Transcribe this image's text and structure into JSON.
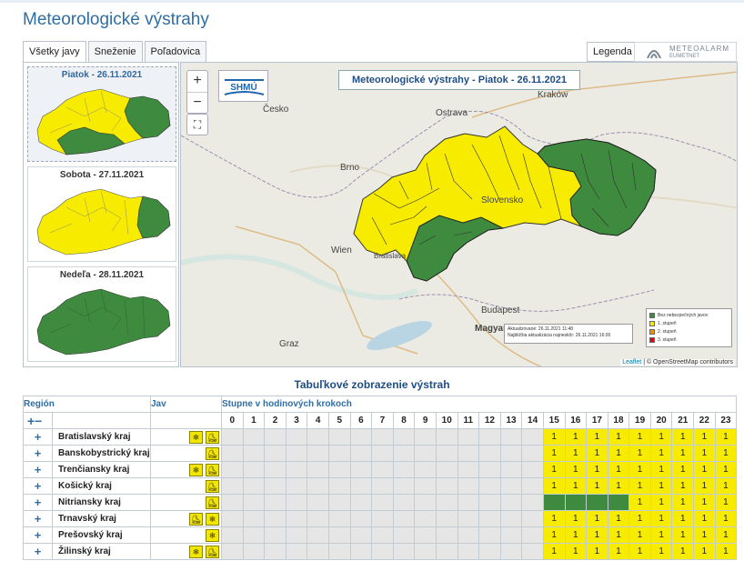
{
  "page": {
    "title": "Meteorologické výstrahy"
  },
  "tabs": [
    {
      "label": "Všetky javy",
      "active": true
    },
    {
      "label": "Sneženie",
      "active": false
    },
    {
      "label": "Poľadovica",
      "active": false
    }
  ],
  "legend_tab": {
    "label": "Legenda"
  },
  "meteoalarm": {
    "line1": "METEOALARM",
    "line2": "EUMETNET"
  },
  "days": [
    {
      "label": "Piatok - 26.11.2021",
      "selected": true
    },
    {
      "label": "Sobota - 27.11.2021",
      "selected": false
    },
    {
      "label": "Nedeľa - 28.11.2021",
      "selected": false
    }
  ],
  "map": {
    "title": "Meteorologické výstrahy - Piatok - 26.11.2021",
    "logo_text": "SHMÚ",
    "zoom_in": "+",
    "zoom_out": "−",
    "fullscreen": "⛶",
    "cities": [
      "Česko",
      "Ostrava",
      "Kraków",
      "Brno",
      "Slovensko",
      "Wien",
      "Bratislava",
      "Budapest",
      "Magyar",
      "Graz"
    ],
    "legend": [
      {
        "label": "Bez nebezpečných javov",
        "color": "#3e8a3f"
      },
      {
        "label": "1. stupeň",
        "color": "#f7ec00"
      },
      {
        "label": "2. stupeň",
        "color": "#f39200"
      },
      {
        "label": "3. stupeň",
        "color": "#e30613"
      }
    ],
    "updated": "Aktualizované: 26.11.2021 11:48",
    "next_update": "Najbližšia aktualizácia najneskôr: 26.11.2021 16:00",
    "attribution_link": "Leaflet",
    "attribution_rest": " | © OpenStreetMap contributors"
  },
  "table": {
    "title": "Tabuľkové zobrazenie výstrah",
    "col_region": "Región",
    "col_jav": "Jav",
    "col_steps": "Stupne v hodinových krokoch",
    "expand_all": "+−",
    "hours": [
      "0",
      "1",
      "2",
      "3",
      "4",
      "5",
      "6",
      "7",
      "8",
      "9",
      "10",
      "11",
      "12",
      "13",
      "14",
      "15",
      "16",
      "17",
      "18",
      "19",
      "20",
      "21",
      "22",
      "23"
    ],
    "rows": [
      {
        "region": "Bratislavský kraj",
        "icons": [
          "snow",
          "ice"
        ],
        "levels": [
          "0",
          "0",
          "0",
          "0",
          "0",
          "0",
          "0",
          "0",
          "0",
          "0",
          "0",
          "0",
          "0",
          "0",
          "0",
          "1",
          "1",
          "1",
          "1",
          "1",
          "1",
          "1",
          "1",
          "1"
        ]
      },
      {
        "region": "Banskobystrický kraj",
        "icons": [
          "ice"
        ],
        "levels": [
          "0",
          "0",
          "0",
          "0",
          "0",
          "0",
          "0",
          "0",
          "0",
          "0",
          "0",
          "0",
          "0",
          "0",
          "0",
          "1",
          "1",
          "1",
          "1",
          "1",
          "1",
          "1",
          "1",
          "1"
        ]
      },
      {
        "region": "Trenčiansky kraj",
        "icons": [
          "snow",
          "ice"
        ],
        "levels": [
          "0",
          "0",
          "0",
          "0",
          "0",
          "0",
          "0",
          "0",
          "0",
          "0",
          "0",
          "0",
          "0",
          "0",
          "0",
          "1",
          "1",
          "1",
          "1",
          "1",
          "1",
          "1",
          "1",
          "1"
        ]
      },
      {
        "region": "Košický kraj",
        "icons": [
          "ice"
        ],
        "levels": [
          "0",
          "0",
          "0",
          "0",
          "0",
          "0",
          "0",
          "0",
          "0",
          "0",
          "0",
          "0",
          "0",
          "0",
          "0",
          "1",
          "1",
          "1",
          "1",
          "1",
          "1",
          "1",
          "1",
          "1"
        ]
      },
      {
        "region": "Nitriansky kraj",
        "icons": [
          "ice"
        ],
        "levels": [
          "0",
          "0",
          "0",
          "0",
          "0",
          "0",
          "0",
          "0",
          "0",
          "0",
          "0",
          "0",
          "0",
          "0",
          "0",
          "g",
          "g",
          "g",
          "g",
          "1",
          "1",
          "1",
          "1",
          "1"
        ]
      },
      {
        "region": "Trnavský kraj",
        "icons": [
          "ice",
          "snow"
        ],
        "levels": [
          "0",
          "0",
          "0",
          "0",
          "0",
          "0",
          "0",
          "0",
          "0",
          "0",
          "0",
          "0",
          "0",
          "0",
          "0",
          "1",
          "1",
          "1",
          "1",
          "1",
          "1",
          "1",
          "1",
          "1"
        ]
      },
      {
        "region": "Prešovský kraj",
        "icons": [
          "snow"
        ],
        "levels": [
          "0",
          "0",
          "0",
          "0",
          "0",
          "0",
          "0",
          "0",
          "0",
          "0",
          "0",
          "0",
          "0",
          "0",
          "0",
          "1",
          "1",
          "1",
          "1",
          "1",
          "1",
          "1",
          "1",
          "1"
        ]
      },
      {
        "region": "Žilinský kraj",
        "icons": [
          "snow",
          "ice"
        ],
        "levels": [
          "0",
          "0",
          "0",
          "0",
          "0",
          "0",
          "0",
          "0",
          "0",
          "0",
          "0",
          "0",
          "0",
          "0",
          "0",
          "1",
          "1",
          "1",
          "1",
          "1",
          "1",
          "1",
          "1",
          "1"
        ]
      }
    ],
    "icon_glyphs": {
      "snow": "❄",
      "ice": "⛸"
    },
    "expand_row": "+"
  },
  "colors": {
    "yellow": "#f7ec00",
    "green": "#3e8a3f",
    "title_blue": "#2f6ea5"
  }
}
